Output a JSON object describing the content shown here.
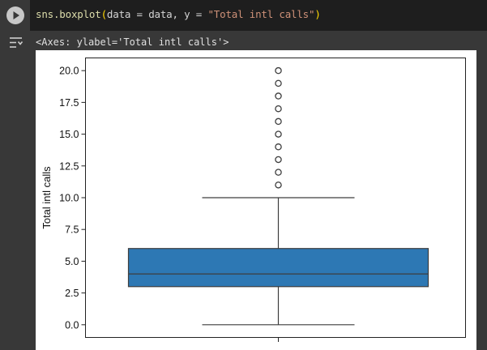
{
  "cell": {
    "code": {
      "fn": "sns.boxplot",
      "open": "(",
      "args_plain": "data = data, y = ",
      "arg_string": "\"Total intl calls\"",
      "close": ")"
    },
    "output_text": "<Axes: ylabel='Total intl calls'>",
    "icons": {
      "run": "play-icon",
      "output": "output-collapse-icon"
    }
  },
  "chart_data": {
    "type": "box",
    "ylabel": "Total intl calls",
    "xlabel": "",
    "ylim": [
      -1,
      21
    ],
    "yticks": [
      "0.0",
      "2.5",
      "5.0",
      "7.5",
      "10.0",
      "12.5",
      "15.0",
      "17.5",
      "20.0"
    ],
    "box": {
      "whisker_low": 0,
      "q1": 3,
      "median": 4,
      "q3": 6,
      "whisker_high": 10,
      "color": "#2d78b4"
    },
    "outliers": [
      11,
      12,
      13,
      14,
      15,
      16,
      17,
      18,
      19,
      20
    ],
    "colors": {
      "box_fill": "#2d78b4",
      "lines": "#3d3d3d"
    }
  }
}
